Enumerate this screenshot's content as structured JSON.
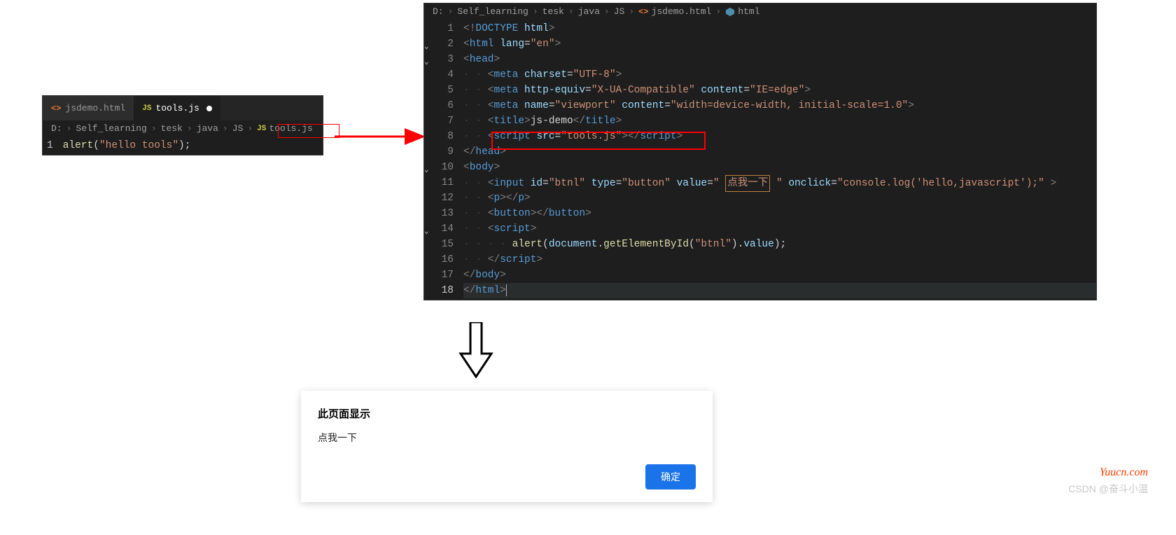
{
  "left_editor": {
    "tabs": [
      {
        "icon": "html-icon",
        "label": "jsdemo.html"
      },
      {
        "icon": "js-icon",
        "label": "tools.js"
      }
    ],
    "breadcrumbs": [
      "D:",
      "Self_learning",
      "tesk",
      "java",
      "JS",
      "tools.js"
    ],
    "line_numbers": [
      "1"
    ],
    "code": {
      "fn": "alert",
      "arg": "\"hello tools\"",
      "end": ");"
    }
  },
  "right_editor": {
    "breadcrumbs": [
      "D:",
      "Self_learning",
      "tesk",
      "java",
      "JS",
      "jsdemo.html",
      "html"
    ],
    "line_numbers": [
      "1",
      "2",
      "3",
      "4",
      "5",
      "6",
      "7",
      "8",
      "9",
      "10",
      "11",
      "12",
      "13",
      "14",
      "15",
      "16",
      "17",
      "18"
    ],
    "code": {
      "doctype": "<!DOCTYPE html>",
      "html_open": "html",
      "lang": "lang",
      "lang_v": "\"en\"",
      "head": "head",
      "meta1_attr": "charset",
      "meta1_v": "\"UTF-8\"",
      "meta2_a1": "http-equiv",
      "meta2_v1": "\"X-UA-Compatible\"",
      "meta2_a2": "content",
      "meta2_v2": "\"IE=edge\"",
      "meta3_a1": "name",
      "meta3_v1": "\"viewport\"",
      "meta3_a2": "content",
      "meta3_v2": "\"width=device-width, initial-scale=1.0\"",
      "title_tag": "title",
      "title_txt": "js-demo",
      "script_tag": "script",
      "script_attr": "src",
      "script_v": "\"tools.js\"",
      "body": "body",
      "input_tag": "input",
      "input_id": "id",
      "input_id_v": "\"btnl\"",
      "input_type": "type",
      "input_type_v": "\"button\"",
      "input_value": "value",
      "input_value_pre": "\"",
      "input_value_txt": "点我一下",
      "input_value_post": "\"",
      "input_onclick": "onclick",
      "input_onclick_v": "\"console.log('hello,javascript');\"",
      "p_tag": "p",
      "button_tag": "button",
      "alert_fn": "alert",
      "doc": "document",
      "get": "getElementById",
      "get_arg": "\"btnl\"",
      "val": "value"
    }
  },
  "dialog": {
    "title": "此页面显示",
    "message": "点我一下",
    "ok": "确定"
  },
  "watermarks": {
    "yuucn": "Yuucn.com",
    "csdn": "CSDN @奋斗小温"
  },
  "icons": {
    "html_badge": "<>",
    "js_badge": "JS"
  }
}
